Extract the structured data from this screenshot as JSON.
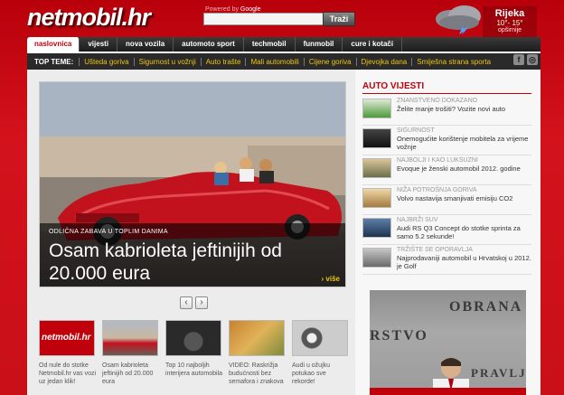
{
  "header": {
    "logo": "netmobil.hr",
    "powered_by": "Powered by",
    "powered_brand": "Google",
    "search_placeholder": "",
    "search_button": "Traži",
    "weather": {
      "city": "Rijeka",
      "temp": "10°- 15°",
      "link": "opširnije"
    }
  },
  "nav": {
    "items": [
      {
        "label": "naslovnica",
        "active": true
      },
      {
        "label": "vijesti"
      },
      {
        "label": "nova vozila"
      },
      {
        "label": "automoto sport"
      },
      {
        "label": "techmobil"
      },
      {
        "label": "funmobil"
      },
      {
        "label": "cure i kotači"
      }
    ]
  },
  "topics": {
    "label": "TOP TEME:",
    "items": [
      "Ušteda goriva",
      "Sigurnost u vožnji",
      "Auto trašte",
      "Mali automobili",
      "Cijene goriva",
      "Djevojka dana",
      "Smiješna strana sporta"
    ]
  },
  "hero": {
    "kicker": "ODLIČNA ZABAVA U TOPLIM DANIMA",
    "title": "Osam kabrioleta jeftinijih od 20.000 eura",
    "more": "› više"
  },
  "thumbnails": [
    {
      "caption": "Od nule do stotke Netmobil.hr vas vozi uz jedan klik!",
      "logo": "netmobil.hr"
    },
    {
      "caption": "Osam kabrioleta jeftinijih od 20.000 eura"
    },
    {
      "caption": "Top 10 najboljih interijera automobila"
    },
    {
      "caption": "VIDEO: Raskrižja budućnosti bez semafora i znakova"
    },
    {
      "caption": "Audi u ožujku potukao sve rekorde!"
    }
  ],
  "auto_vijesti": {
    "heading": "AUTO VIJESTI",
    "items": [
      {
        "category": "ZNANSTVENO DOKAZANO",
        "title": "Želite manje trošiti? Vozite novi auto"
      },
      {
        "category": "SIGURNOST",
        "title": "Onemogućite korištenje mobitela za vrijeme vožnje"
      },
      {
        "category": "NAJBOLJI I KAO LUKSUZNI",
        "title": "Evoque je ženski automobil 2012. godine"
      },
      {
        "category": "NIŽA POTROŠNJA GORIVA",
        "title": "Volvo nastavija smanjivati emisiju CO2"
      },
      {
        "category": "NAJBRŽI SUV",
        "title": "Audi RS Q3 Concept do stotke sprinta za samo 5.2 sekunde!"
      },
      {
        "category": "TRŽIŠTE SE OPORAVLJA",
        "title": "Najprodavaniji automobil u Hrvatskoj u 2012. je Golf"
      }
    ]
  },
  "ad": {
    "line1": "OBRANA",
    "line2": "RSTVO",
    "line3": "PRAVLJE"
  },
  "colors": {
    "brand_red": "#c0000a",
    "nav_dark": "#1c1c1c",
    "topic_yellow": "#f1c40f"
  }
}
